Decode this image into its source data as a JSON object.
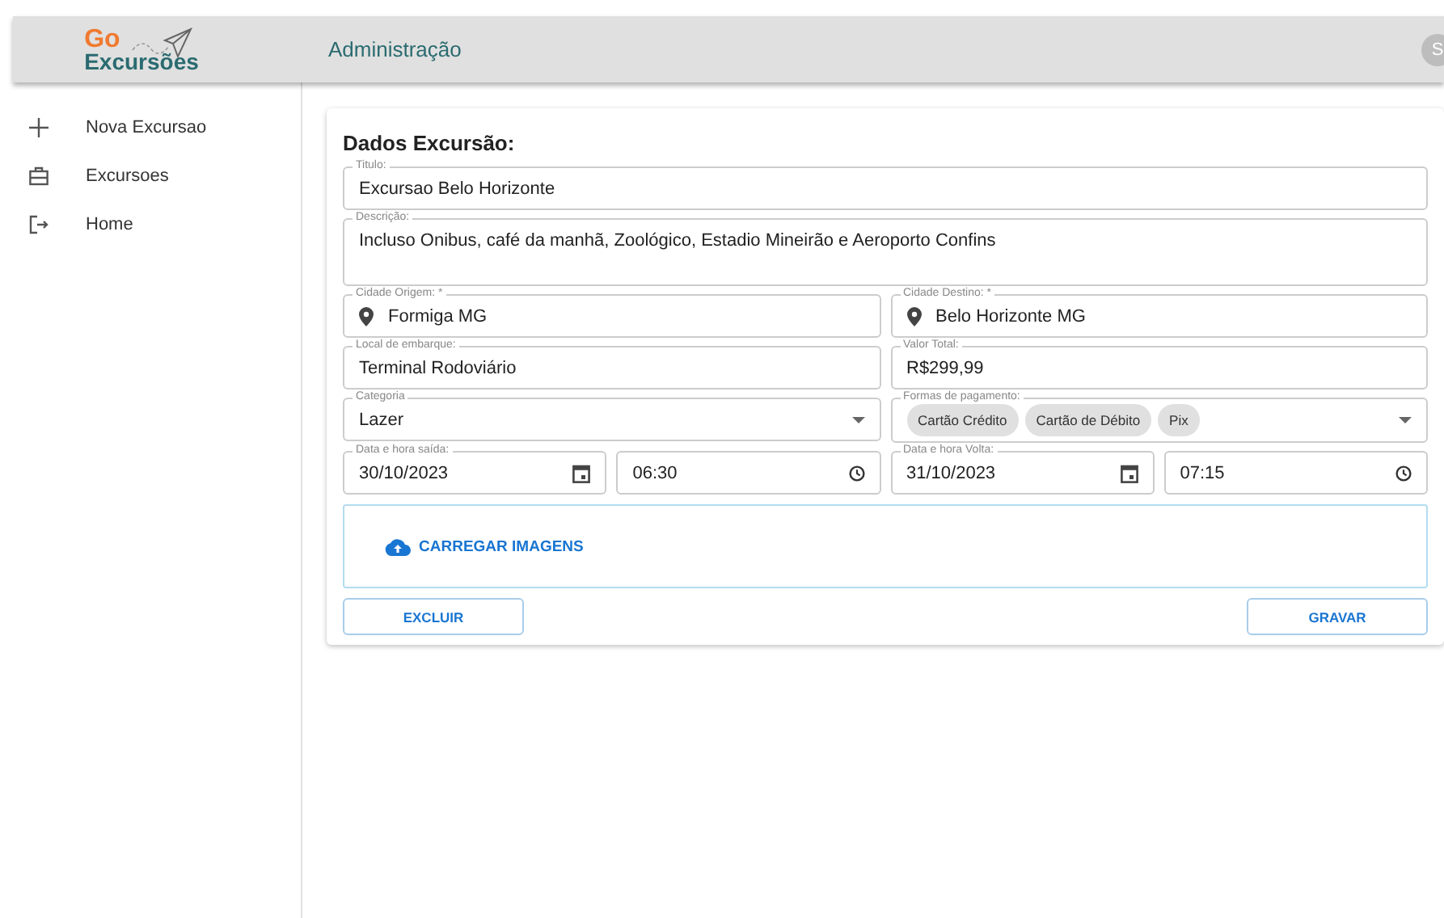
{
  "logo": {
    "top": "Go",
    "bottom": "Excursões"
  },
  "header": {
    "title": "Administração",
    "avatar": "S"
  },
  "sidebar": {
    "items": [
      {
        "label": "Nova Excursao"
      },
      {
        "label": "Excursoes"
      },
      {
        "label": "Home"
      }
    ]
  },
  "form": {
    "title": "Dados Excursão:",
    "rows": [
      [
        {
          "kind": "text",
          "label": "Titulo:",
          "value": "Excursao Belo Horizonte"
        }
      ],
      [
        {
          "kind": "textarea",
          "label": "Descrição:",
          "value": "Incluso Onibus, café da manhã, Zoológico, Estadio Mineirão e Aeroporto Confins"
        }
      ],
      [
        {
          "kind": "location",
          "label": "Cidade Origem: *",
          "value": "Formiga MG"
        },
        {
          "kind": "location",
          "label": "Cidade Destino: *",
          "value": "Belo Horizonte MG"
        }
      ],
      [
        {
          "kind": "text",
          "label": "Local de embarque:",
          "value": "Terminal Rodoviário"
        },
        {
          "kind": "text",
          "label": "Valor Total:",
          "value": "R$299,99"
        }
      ],
      [
        {
          "kind": "select",
          "label": "Categoria",
          "value": "Lazer"
        },
        {
          "kind": "chips",
          "label": "Formas de pagamento:",
          "chips": [
            "Cartão Crédito",
            "Cartão de Débito",
            "Pix"
          ]
        }
      ],
      [
        {
          "kind": "date",
          "label": "Data e hora saída:",
          "value": "30/10/2023"
        },
        {
          "kind": "time",
          "value": "06:30"
        },
        {
          "kind": "date",
          "label": "Data e hora Volta:",
          "value": "31/10/2023"
        },
        {
          "kind": "time",
          "value": "07:15"
        }
      ]
    ],
    "upload": "CARREGAR IMAGENS",
    "buttons": [
      "EXCLUIR",
      "GRAVAR"
    ]
  }
}
